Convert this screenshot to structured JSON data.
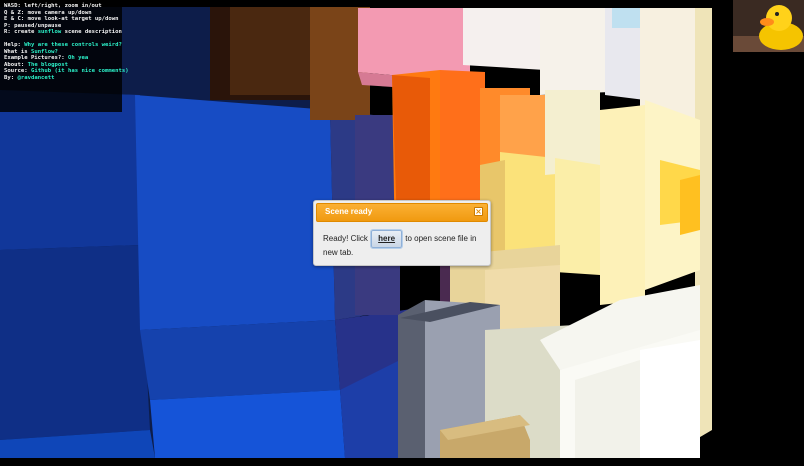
{
  "help": {
    "controls": [
      "WASD: left/right, zoom in/out",
      "Q & Z: move camera up/down",
      "E & C: move look-at target up/down",
      "P: paused/unpause"
    ],
    "create_prefix": "R: create ",
    "create_link": "sunflow",
    "create_suffix": " scene description",
    "links": [
      {
        "label": "Help: ",
        "link": "Why are these controls weird?"
      },
      {
        "label": "What is ",
        "link": "Sunflow?"
      },
      {
        "label": "Example Pictures?: ",
        "link": "Oh yea"
      },
      {
        "label": "About: ",
        "link": "The blogpost"
      },
      {
        "label": "Source: ",
        "link": "Github (it has nice comments)"
      },
      {
        "label": "By: ",
        "link": "@ravdancett"
      }
    ]
  },
  "dialog": {
    "title": "Scene ready",
    "close_glyph": "×",
    "message_before": "Ready! Click ",
    "button_label": "here",
    "message_after": " to open scene file in new tab."
  },
  "colors": {
    "dialog_header": "#f5a623",
    "link": "#2cf0c8",
    "dialog_button": "#c9d6e6"
  }
}
